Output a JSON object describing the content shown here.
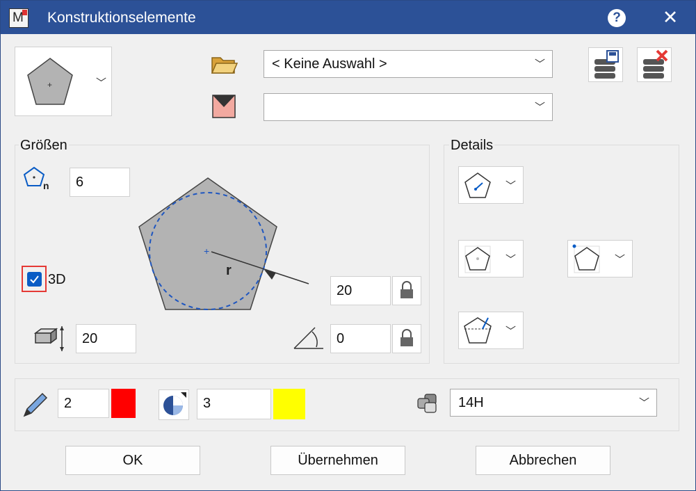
{
  "window": {
    "title": "Konstruktionselemente"
  },
  "top": {
    "folder_combo_value": "< Keine Auswahl >",
    "second_combo_value": ""
  },
  "groessen": {
    "label": "Größen",
    "corners": "6",
    "checkbox_3d_label": "3D",
    "checkbox_3d_checked": true,
    "height": "20",
    "radius": "20",
    "angle": "0",
    "radius_letter": "r",
    "corner_letter": "n"
  },
  "details": {
    "label": "Details"
  },
  "bottom": {
    "pen_thickness": "2",
    "pen_color": "#ff0000",
    "pattern_value": "3",
    "pattern_color": "#ffff00",
    "layer_value": "14H"
  },
  "buttons": {
    "ok": "OK",
    "apply": "Übernehmen",
    "cancel": "Abbrechen"
  },
  "colors": {
    "titlebar": "#2c5197",
    "accent_blue": "#0a5cc5",
    "shape_fill": "#b3b3b3"
  }
}
